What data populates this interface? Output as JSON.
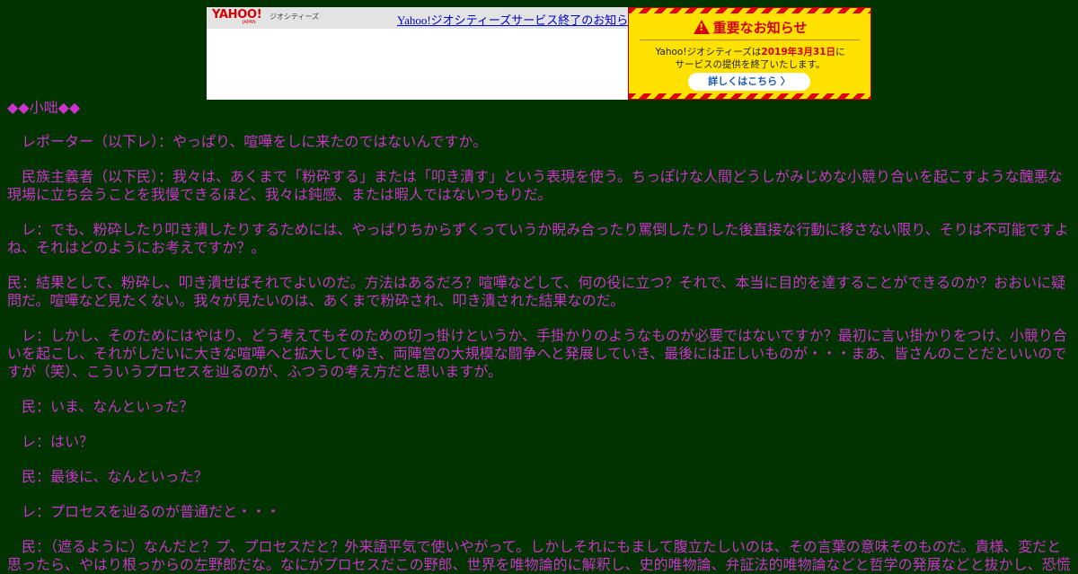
{
  "banner": {
    "logo": "YAHOO!",
    "logo_sub": "JAPAN",
    "service_name": "ジオシティーズ",
    "link_text": "Yahoo!ジオシティーズサービス終了のお知らせ",
    "notice_heading": "重要なお知らせ",
    "notice_line1_before": "Yahoo!ジオシティーズは",
    "notice_line1_date": "2019年3月31日",
    "notice_line1_after": "に",
    "notice_line2": "サービスの提供を終了いたします。",
    "details_button": "詳しくはこちら 〉",
    "icon": "warning-triangle-icon"
  },
  "page": {
    "section_title": "◆◆小咄◆◆",
    "paragraphs": [
      "　レポーター（以下レ）：やっぱり、喧嘩をしに来たのではないんですか。",
      "　民族主義者（以下民）：我々は、あくまで「粉砕する」または「叩き潰す」という表現を使う。ちっぽけな人間どうしがみじめな小競り合いを起こすような醜悪な現場に立ち会うことを我慢できるほど、我々は鈍感、または暇人ではないつもりだ。",
      "　レ：でも、粉砕したり叩き潰したりするためには、やっぱりちからずくっていうか睨み合ったり罵倒したりした後直接な行動に移さない限り、そりは不可能ですよね、それはどのようにお考えですか？。",
      "民：結果として、粉砕し、叩き潰せばそれでよいのだ。方法はあるだろ？喧嘩などして、何の役に立つ？それで、本当に目的を達することができるのか？おおいに疑問だ。喧嘩など見たくない。我々が見たいのは、あくまで粉砕され、叩き潰された結果なのだ。",
      "　レ：しかし、そのためにはやはり、どう考えてもそのための切っ掛けというか、手掛かりのようなものが必要ではないですか？最初に言い掛かりをつけ、小競り合いを起こし、それがしだいに大きな喧嘩へと拡大してゆき、両陣営の大規模な闘争へと発展していき、最後には正しいものが・・・まあ、皆さんのことだといいのですが（笑）、こういうプロセスを辿るのが、ふつうの考え方だと思いますが。",
      "　民：いま、なんといった？",
      "　レ：はい？",
      "　民：最後に、なんといった？",
      "　レ：プロセスを辿るのが普通だと・・・",
      "　民：（遮るように）なんだと？プ、プロセスだと？外来語平気で使いやがって。しかしそれにもまして腹立たしいのは、その言葉の意味そのものだ。貴様、変だと思ったら、やはり根っからの左野郎だな。なにがプロセスだこの野郎、世界を唯物論的に解釈し、史的唯物論、弁証法的唯物論などと哲学の発展などと抜かし、恐慌"
    ]
  },
  "colors": {
    "page_background": "#003300",
    "text": "#cc33cc",
    "link": "#0000cc",
    "notice_yellow": "#ffe100",
    "notice_red": "#d40000"
  }
}
